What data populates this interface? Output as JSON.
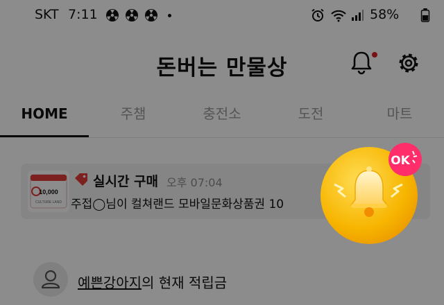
{
  "status_bar": {
    "carrier": "SKT",
    "time": "7:11",
    "battery": "58%",
    "icons": [
      "radiation-icon",
      "radiation-icon",
      "radiation-icon",
      "alarm-icon",
      "wifi-icon",
      "signal-icon",
      "battery-icon"
    ]
  },
  "header": {
    "title": "돈버는 만물상",
    "bell_icon": "bell-icon",
    "settings_icon": "gear-icon",
    "notification_badge_color": "#d81f26"
  },
  "tabs": [
    {
      "label": "HOME",
      "active": true
    },
    {
      "label": "주챔",
      "active": false
    },
    {
      "label": "충전소",
      "active": false
    },
    {
      "label": "도전",
      "active": false
    },
    {
      "label": "마트",
      "active": false
    }
  ],
  "realtime_card": {
    "label": "실시간 구매",
    "time": "오후 07:04",
    "message": "주접◯님이 컬쳐랜드 모바일문화상품권 10",
    "thumbnail": {
      "amount": "10,000",
      "brand": "CULTURE LAND"
    },
    "tag_color": "#e23b3b"
  },
  "savings": {
    "nickname": "예쁜강아지",
    "suffix": "의 현재 적립금"
  },
  "floating_bell": {
    "badge": "OK",
    "badge_color": "#ff2d6a",
    "icon": "bell-icon"
  },
  "colors": {
    "overlay": "rgba(0,0,0,0.45)",
    "accent_red": "#d81f26"
  }
}
